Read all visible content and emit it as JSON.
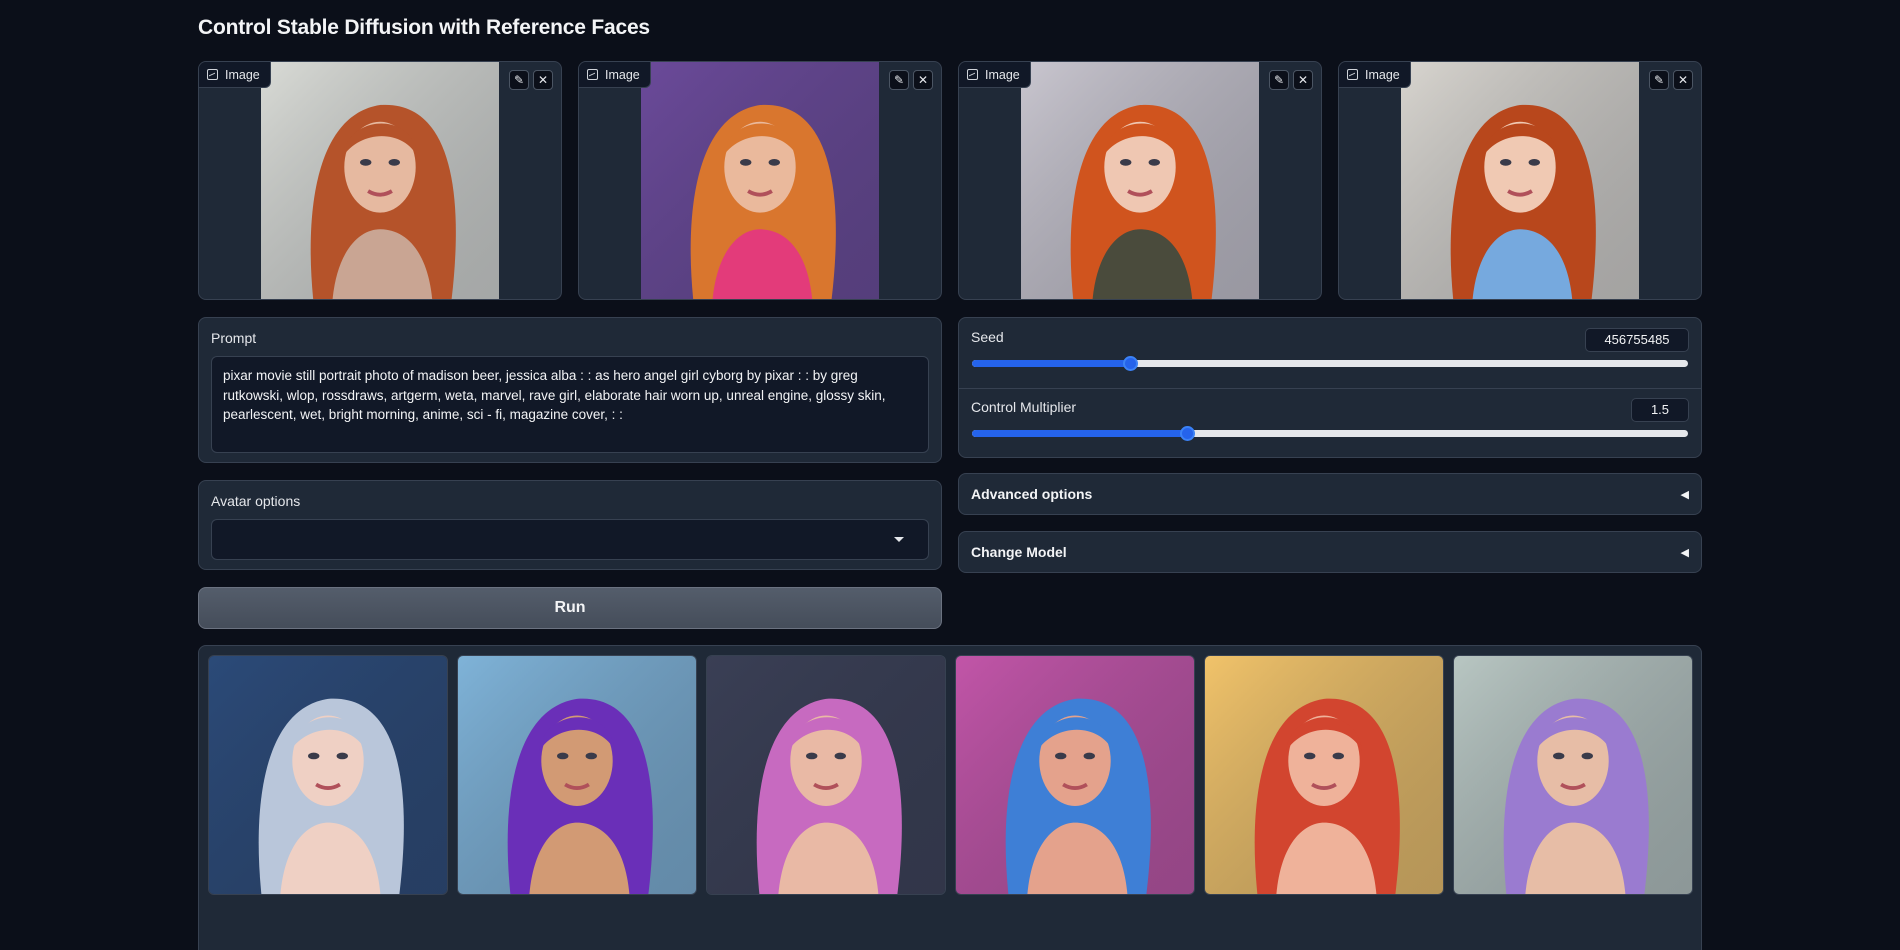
{
  "page": {
    "title": "Control Stable Diffusion with Reference Faces"
  },
  "reference_images": [
    {
      "tag": "Image",
      "edit_icon": "pencil-icon",
      "clear_icon": "close-icon",
      "hair": "#b5532a",
      "bg": "#d9dbd6",
      "skin": "#e6b9a0",
      "top": "#c9a593"
    },
    {
      "tag": "Image",
      "edit_icon": "pencil-icon",
      "clear_icon": "close-icon",
      "hair": "#d9762e",
      "bg": "#6b4a9a",
      "skin": "#eab99c",
      "top": "#e33b7a"
    },
    {
      "tag": "Image",
      "edit_icon": "pencil-icon",
      "clear_icon": "close-icon",
      "hair": "#d0541e",
      "bg": "#c9c6cf",
      "skin": "#efc7b2",
      "top": "#4a4b3c"
    },
    {
      "tag": "Image",
      "edit_icon": "pencil-icon",
      "clear_icon": "close-icon",
      "hair": "#b8471c",
      "bg": "#d8d5cf",
      "skin": "#f0c9b3",
      "top": "#76a9de"
    }
  ],
  "prompt": {
    "label": "Prompt",
    "value": "pixar movie still portrait photo of madison beer, jessica alba : : as hero angel girl cyborg by pixar : : by greg rutkowski, wlop, rossdraws, artgerm, weta, marvel, rave girl, elaborate hair worn up, unreal engine, glossy skin, pearlescent, wet, bright morning, anime, sci - fi, magazine cover, : :"
  },
  "avatar_options": {
    "label": "Avatar options",
    "value": ""
  },
  "run_button": {
    "label": "Run"
  },
  "seed": {
    "label": "Seed",
    "value": "456755485",
    "fraction": 0.22
  },
  "control_multiplier": {
    "label": "Control Multiplier",
    "value": "1.5",
    "fraction": 0.3
  },
  "advanced_options": {
    "label": "Advanced options",
    "arrow": "◀"
  },
  "change_model": {
    "label": "Change Model",
    "arrow": "◀"
  },
  "accent_color": "#2563eb",
  "gallery": [
    {
      "hair": "#b9c6da",
      "bg": "#2b4a78",
      "skin": "#efd0c4"
    },
    {
      "hair": "#6a2fb8",
      "bg": "#7fb3d8",
      "skin": "#d29a74"
    },
    {
      "hair": "#c76ac0",
      "bg": "#3a3f55",
      "skin": "#e9b9a5"
    },
    {
      "hair": "#3e7fd6",
      "bg": "#c255a8",
      "skin": "#e4a28c"
    },
    {
      "hair": "#d2452f",
      "bg": "#f1c36a",
      "skin": "#efb29a"
    },
    {
      "hair": "#9a7bd0",
      "bg": "#b8c6c2",
      "skin": "#e7bda6"
    }
  ]
}
